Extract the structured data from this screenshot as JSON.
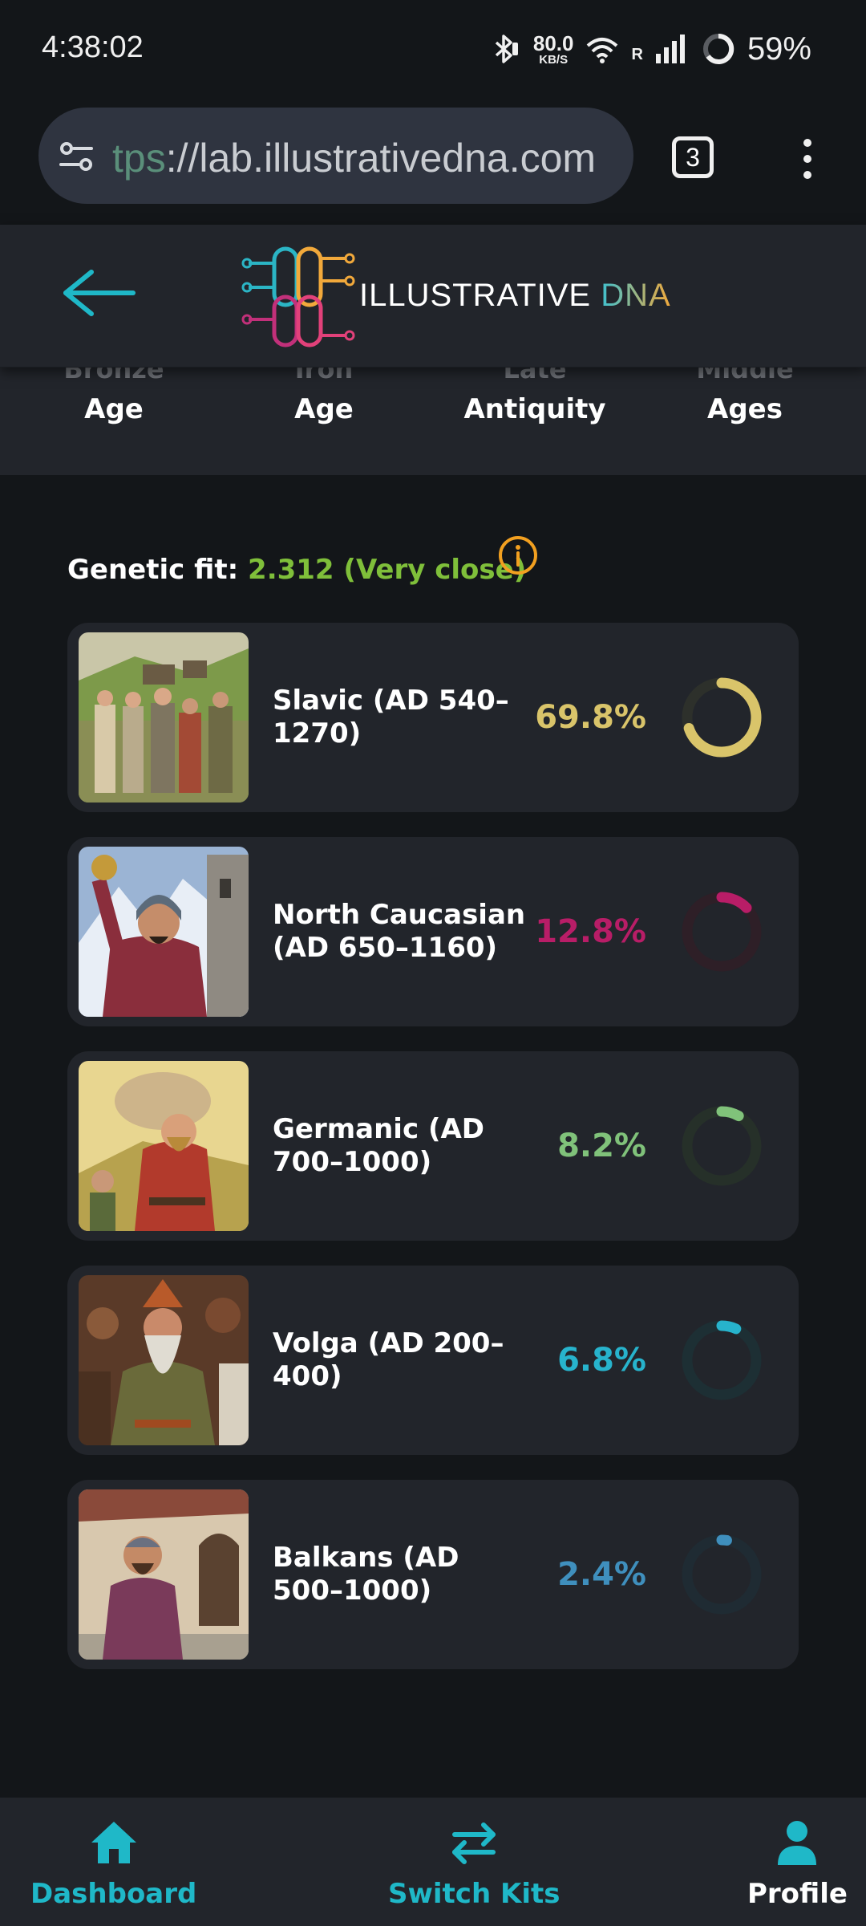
{
  "status_bar": {
    "time": "4:38:02",
    "net_speed_value": "80.0",
    "net_speed_unit": "KB/S",
    "roaming": "R",
    "battery": "59%"
  },
  "browser": {
    "url_prefix": "tps",
    "url_rest": "://lab.illustrativedna.com",
    "tabs_count": "3"
  },
  "header": {
    "logo_word1": "ILLUSTRATIVE ",
    "logo_word2": "DNA"
  },
  "eras": [
    {
      "top": "Bronze",
      "bottom": "Age"
    },
    {
      "top": "Iron",
      "bottom": "Age"
    },
    {
      "top": "Late",
      "bottom": "Antiquity"
    },
    {
      "top": "Middle",
      "bottom": "Ages"
    }
  ],
  "genetic_fit": {
    "label": "Genetic fit: ",
    "value": "2.312 (Very close)"
  },
  "populations": [
    {
      "name": "Slavic (AD 540–1270)",
      "percent": "69.8%",
      "fraction": 0.698,
      "color": "#d9c46a",
      "track": "#2d302b"
    },
    {
      "name": "North Caucasian (AD 650–1160)",
      "percent": "12.8%",
      "fraction": 0.128,
      "color": "#b81d67",
      "track": "#2e1f27"
    },
    {
      "name": "Germanic (AD 700–1000)",
      "percent": "8.2%",
      "fraction": 0.082,
      "color": "#80c27a",
      "track": "#263029"
    },
    {
      "name": "Volga (AD 200–400)",
      "percent": "6.8%",
      "fraction": 0.068,
      "color": "#27b3cc",
      "track": "#1d2f34"
    },
    {
      "name": "Balkans (AD 500–1000)",
      "percent": "2.4%",
      "fraction": 0.024,
      "color": "#3f8fbd",
      "track": "#1f2b33"
    }
  ],
  "nav": {
    "dashboard": "Dashboard",
    "switch_kits": "Switch Kits",
    "profile": "Profile"
  },
  "colors": {
    "accent": "#1fb8c8",
    "background": "#131619",
    "card": "#22252b",
    "fit_green": "#7fbf3a",
    "info_orange": "#f2a020"
  }
}
